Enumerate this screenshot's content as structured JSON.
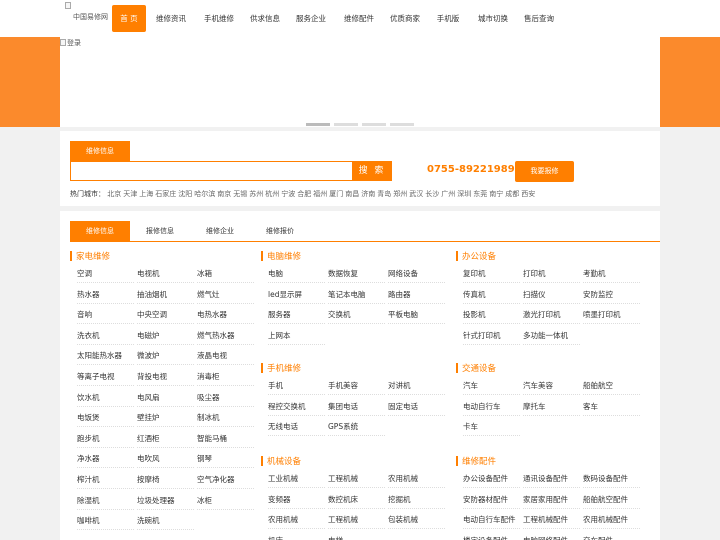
{
  "header": {
    "logo_alt": "中国易修网",
    "nav": [
      "首 页",
      "维修资讯",
      "手机维修",
      "供求信息",
      "服务企业",
      "维修配件",
      "优质商家",
      "手机版",
      "城市切换",
      "售后查询"
    ]
  },
  "banner": {
    "alt": "登录"
  },
  "search": {
    "tab_label": "维修信息",
    "input_value": "",
    "button_label": "搜 索",
    "phone": "0755-89221989",
    "repair_button": "我要报修",
    "hot_label": "热门城市：",
    "hot_cities": [
      "北京",
      "天津",
      "上海",
      "石家庄",
      "沈阳",
      "哈尔滨",
      "南京",
      "无锡",
      "苏州",
      "杭州",
      "宁波",
      "合肥",
      "福州",
      "厦门",
      "南昌",
      "济南",
      "青岛",
      "郑州",
      "武汉",
      "长沙",
      "广州",
      "深圳",
      "东莞",
      "南宁",
      "成都",
      "西安"
    ]
  },
  "categories": {
    "tabs": [
      "维修信息",
      "报修信息",
      "维修企业",
      "维修报价"
    ],
    "groups": [
      {
        "title": "家电维修",
        "items": [
          "空调",
          "电视机",
          "冰箱",
          "热水器",
          "抽油烟机",
          "燃气灶",
          "音响",
          "中央空调",
          "电热水器",
          "洗衣机",
          "电磁炉",
          "燃气热水器",
          "太阳能热水器",
          "微波炉",
          "液晶电视",
          "等离子电视",
          "背投电视",
          "消毒柜",
          "饮水机",
          "电风扇",
          "吸尘器",
          "电饭煲",
          "壁挂炉",
          "制冰机",
          "跑步机",
          "红酒柜",
          "智能马桶",
          "净水器",
          "电吹风",
          "钢琴",
          "榨汁机",
          "按摩椅",
          "空气净化器",
          "除湿机",
          "垃圾处理器",
          "冰柜",
          "咖啡机",
          "洗碗机"
        ]
      },
      {
        "title": "电脑维修",
        "items": [
          "电脑",
          "数据恢复",
          "网络设备",
          "led显示屏",
          "笔记本电脑",
          "路由器",
          "服务器",
          "交换机",
          "平板电脑",
          "上网本"
        ]
      },
      {
        "title": "手机维修",
        "items": [
          "手机",
          "手机美容",
          "对讲机",
          "程控交换机",
          "集团电话",
          "固定电话",
          "无线电话",
          "GPS系统"
        ]
      },
      {
        "title": "机械设备",
        "items": [
          "工业机械",
          "工程机械",
          "农用机械",
          "变频器",
          "数控机床",
          "挖掘机",
          "农用机械",
          "工程机械",
          "包装机械",
          "机床",
          "电梯"
        ]
      },
      {
        "title": "办公设备",
        "items": [
          "复印机",
          "打印机",
          "考勤机",
          "传真机",
          "扫描仪",
          "安防监控",
          "投影机",
          "激光打印机",
          "喷墨打印机",
          "针式打印机",
          "多功能一体机"
        ]
      },
      {
        "title": "交通设备",
        "items": [
          "汽车",
          "汽车美容",
          "船舶航空",
          "电动自行车",
          "摩托车",
          "客车",
          "卡车"
        ]
      },
      {
        "title": "维修配件",
        "items": [
          "办公设备配件",
          "通讯设备配件",
          "数码设备配件",
          "安防器材配件",
          "家居家用配件",
          "船舶航空配件",
          "电动自行车配件",
          "工程机械配件",
          "农用机械配件",
          "楼宇设备配件",
          "电脑网络配件",
          "交车配件"
        ]
      }
    ]
  }
}
